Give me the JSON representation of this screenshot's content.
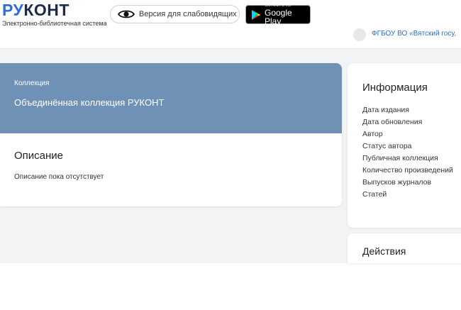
{
  "header": {
    "logo_part1": "РУ",
    "logo_part2": "КОНТ",
    "subtitle": "Электронно-библиотечная система",
    "vision_button": "Версия для слабовидящих",
    "gplay_small": "СКАЧАЙТЕ ИЗ",
    "gplay_big": "Google Play",
    "organization": "ФГБОУ ВО «Вятский госу,"
  },
  "collection": {
    "label": "Коллекция",
    "title": "Объединённая коллекция РУКОНТ"
  },
  "description": {
    "heading": "Описание",
    "text": "Описание пока отсутствует"
  },
  "info": {
    "heading": "Информация",
    "items": [
      "Дата издания",
      "Дата обновления",
      "Автор",
      "Статус автора",
      "Публичная коллекция",
      "Количество произведений",
      "Выпусков журналов",
      "Статей"
    ]
  },
  "actions": {
    "heading": "Действия"
  },
  "colors": {
    "brand_blue": "#2b6fd6",
    "collection_header": "#6f91b6",
    "page_background": "#f2f3f5"
  }
}
